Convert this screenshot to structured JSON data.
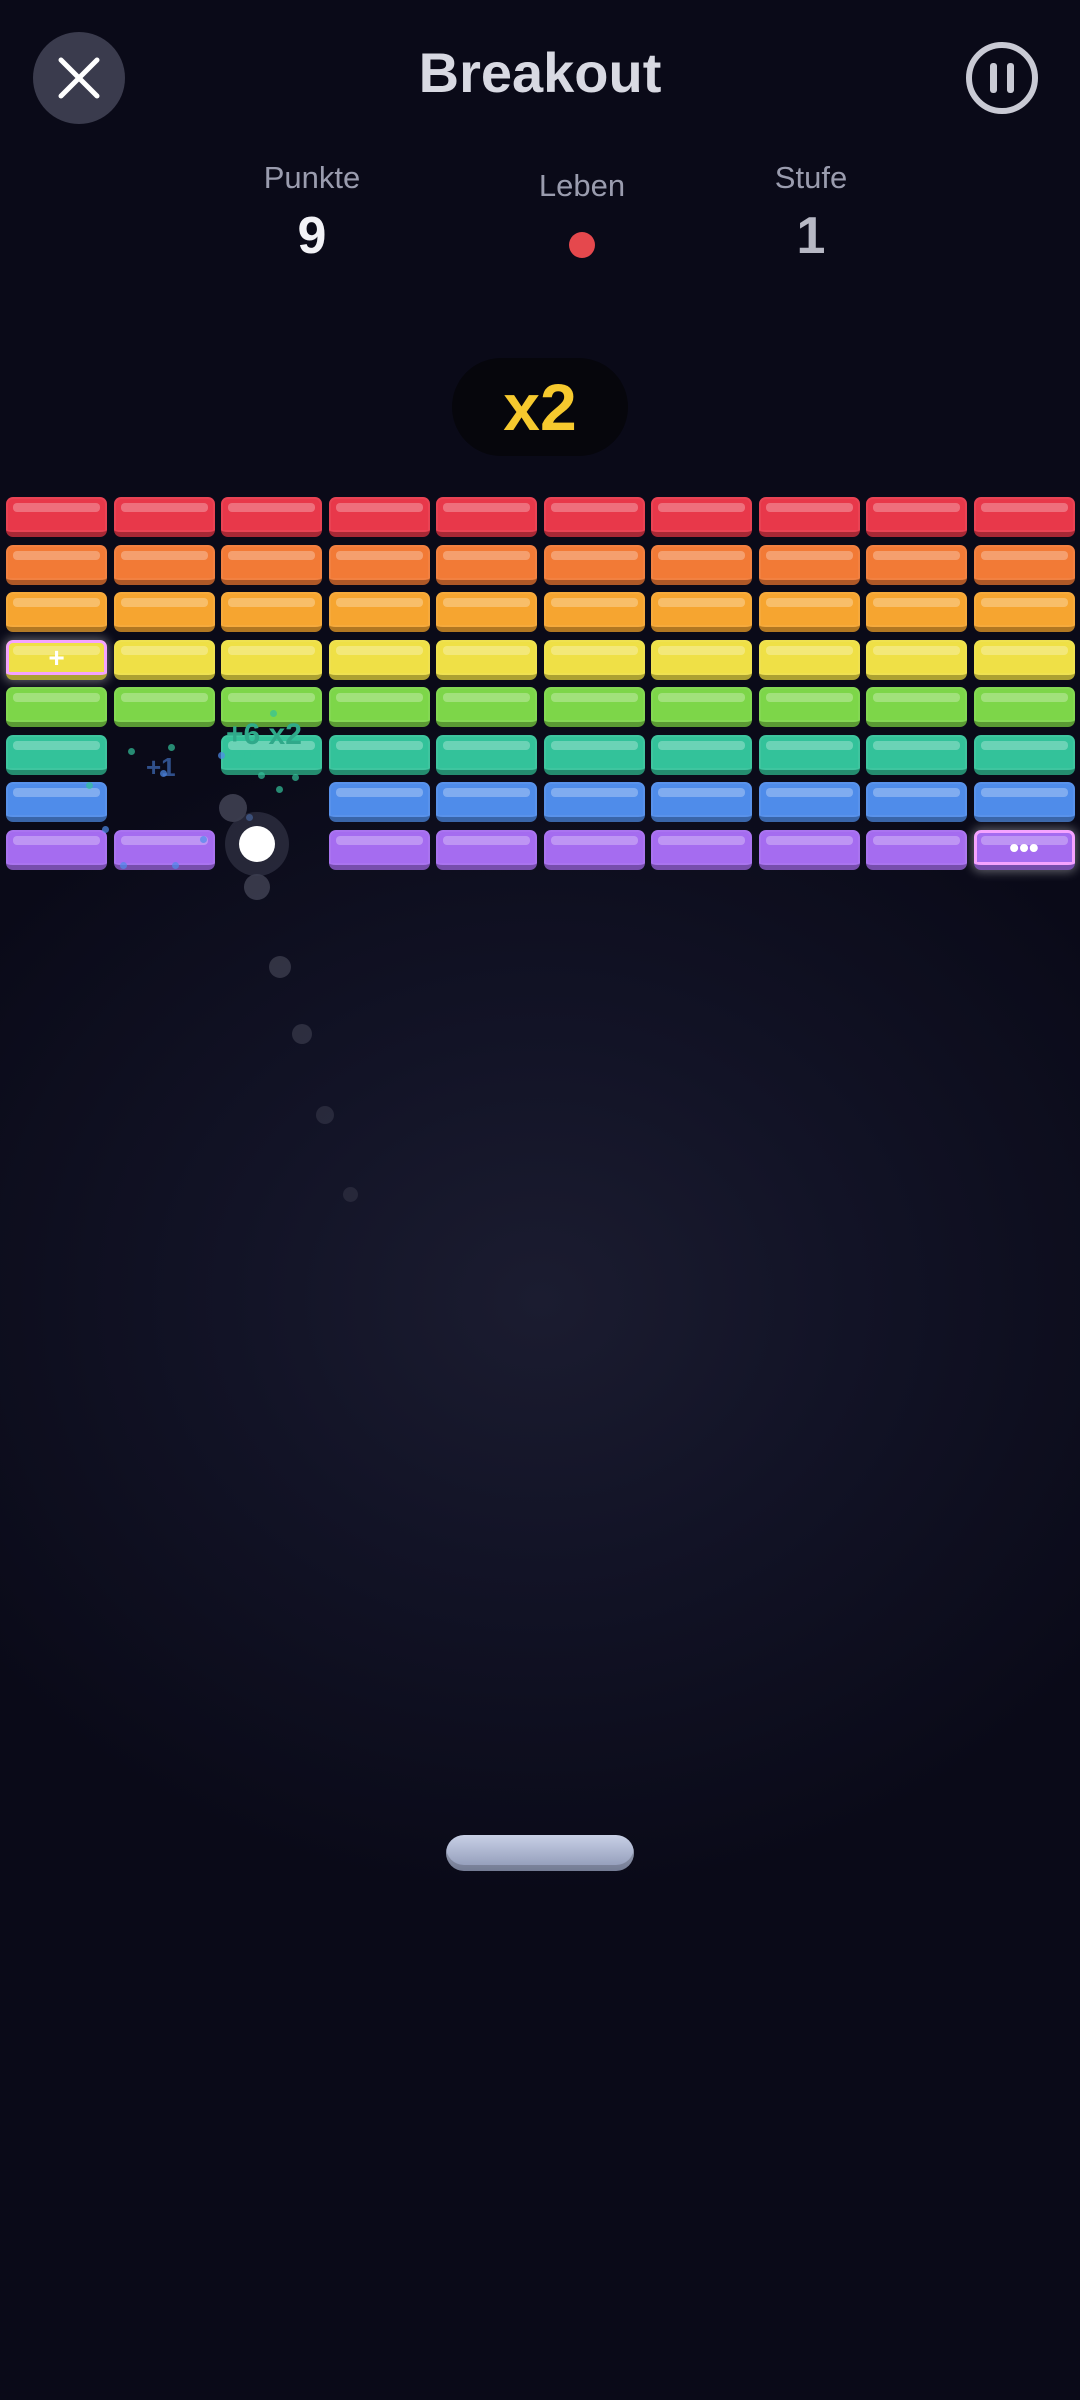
{
  "header": {
    "title": "Breakout",
    "close_icon": "close-icon",
    "pause_icon": "pause-icon"
  },
  "stats": {
    "score_label": "Punkte",
    "score_value": "9",
    "lives_label": "Leben",
    "lives_count": 1,
    "level_label": "Stufe",
    "level_value": "1"
  },
  "multiplier": "x2",
  "floating_texts": {
    "points": "+6 x2",
    "bonus": "+1"
  },
  "brick_marks": {
    "expand": "+",
    "multiball": "•••"
  },
  "colors": {
    "rows": [
      "#e8384a",
      "#f27a36",
      "#f6a530",
      "#efe046",
      "#7dd649",
      "#33c29a",
      "#4f8cea",
      "#a56cf0"
    ],
    "multiplier_text": "#f6c92e",
    "life": "#e5484d",
    "points_text": "#2fa98a",
    "bonus_text": "#4a7fd8"
  },
  "bricks": {
    "rows": 8,
    "cols": 10,
    "broken": [
      [
        5,
        1
      ],
      [
        6,
        1
      ],
      [
        6,
        2
      ],
      [
        7,
        2
      ]
    ],
    "special": [
      [
        3,
        0,
        "expand"
      ],
      [
        7,
        9,
        "multiball"
      ]
    ]
  }
}
